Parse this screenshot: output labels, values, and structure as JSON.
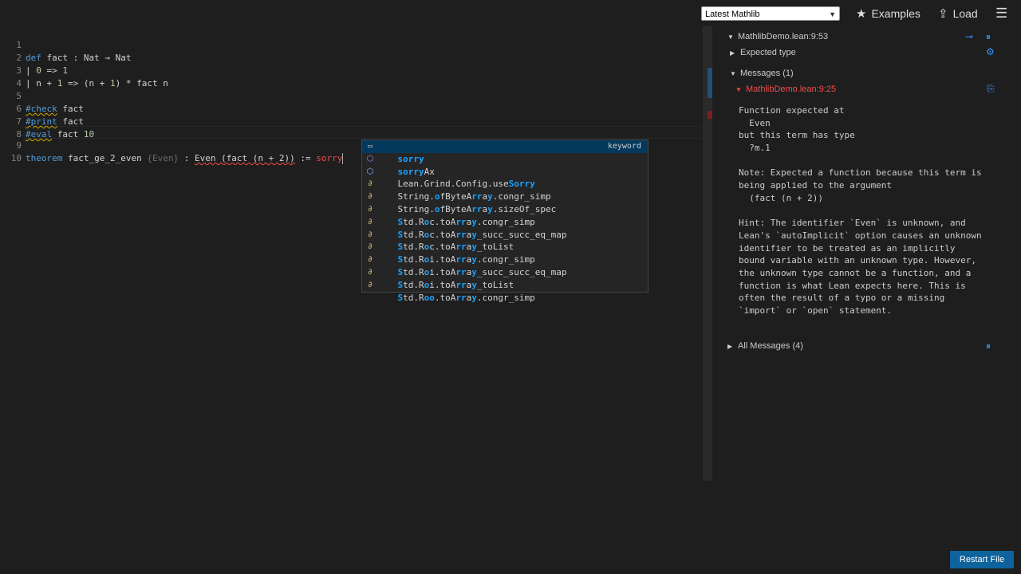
{
  "topbar": {
    "version_select": "Latest Mathlib",
    "examples_label": "Examples",
    "load_label": "Load"
  },
  "editor": {
    "lines": [
      {
        "n": "1",
        "text": "def fact : Nat → Nat"
      },
      {
        "n": "2",
        "text": "  | 0 => 1"
      },
      {
        "n": "3",
        "text": "  | n + 1 => (n + 1) * fact n"
      },
      {
        "n": "4",
        "text": ""
      },
      {
        "n": "5",
        "text": "#check fact"
      },
      {
        "n": "6",
        "text": "#print fact"
      },
      {
        "n": "7",
        "text": "#eval fact 10"
      },
      {
        "n": "8",
        "text": ""
      },
      {
        "n": "9",
        "text": "theorem fact_ge_2_even {Even} : Even (fact (n + 2)) := sorry"
      },
      {
        "n": "10",
        "text": ""
      }
    ]
  },
  "suggest": {
    "items": [
      {
        "label": "sorry",
        "detail": "keyword",
        "icon": "keyword-icon"
      },
      {
        "label": "sorryAx",
        "icon": "function-icon"
      },
      {
        "label": "Lean.Grind.Config.useSorry",
        "icon": "field-icon"
      },
      {
        "label": "String.ofByteArray.congr_simp",
        "icon": "theorem-icon"
      },
      {
        "label": "String.ofByteArray.sizeOf_spec",
        "icon": "theorem-icon"
      },
      {
        "label": "Std.Roc.toArray.congr_simp",
        "icon": "theorem-icon"
      },
      {
        "label": "Std.Roc.toArray_succ_succ_eq_map",
        "icon": "theorem-icon"
      },
      {
        "label": "Std.Roc.toArray_toList",
        "icon": "theorem-icon"
      },
      {
        "label": "Std.Roi.toArray.congr_simp",
        "icon": "theorem-icon"
      },
      {
        "label": "Std.Roi.toArray_succ_succ_eq_map",
        "icon": "theorem-icon"
      },
      {
        "label": "Std.Roi.toArray_toList",
        "icon": "theorem-icon"
      },
      {
        "label": "Std.Roo.toArray.congr_simp",
        "icon": "theorem-icon"
      }
    ]
  },
  "infoview": {
    "position": "MathlibDemo.lean:9:53",
    "expected_type": "Expected type",
    "messages_header": "Messages (1)",
    "message_location": "MathlibDemo.lean:9:25",
    "message_lines": [
      "Function expected at",
      "  Even",
      "but this term has type",
      "  ?m.1",
      "",
      "Note: Expected a function because this term is",
      "being applied to the argument",
      "  (fact (n + 2))",
      "",
      "Hint: The identifier `Even` is unknown, and",
      "Lean's `autoImplicit` option causes an unknown",
      "identifier to be treated as an implicitly",
      "bound variable with an unknown type. However,",
      "the unknown type cannot be a function, and a",
      "function is what Lean expects here. This is",
      "often the result of a typo or a missing",
      "`import` or `open` statement."
    ],
    "all_messages": "All Messages (4)",
    "restart_label": "Restart File"
  }
}
